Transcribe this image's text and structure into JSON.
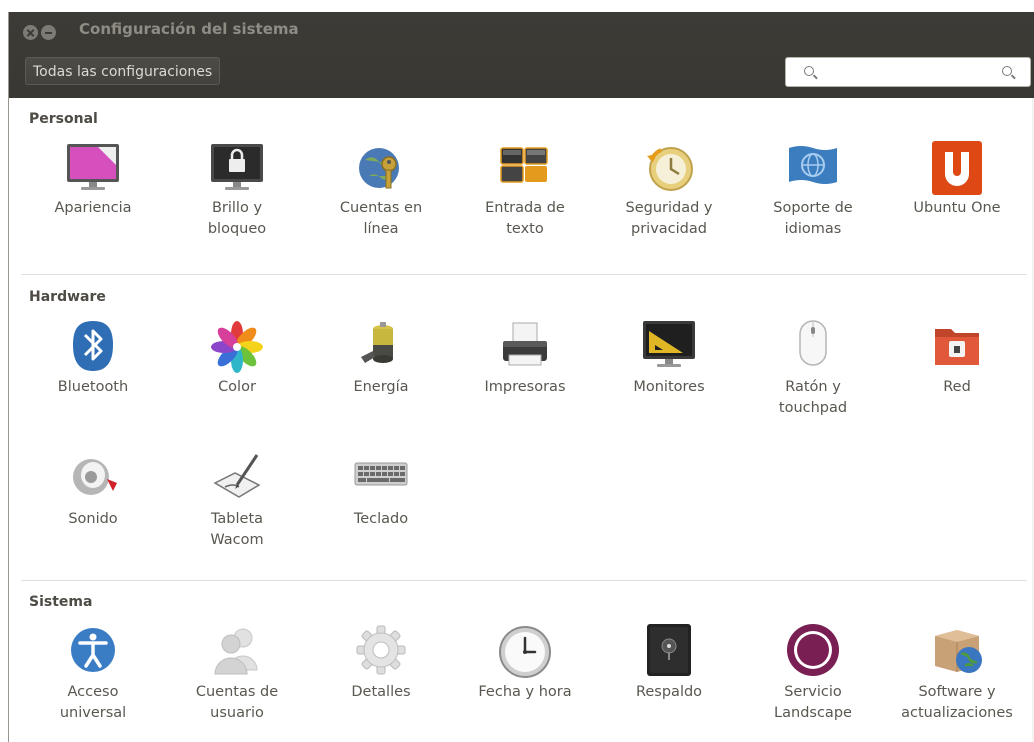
{
  "window": {
    "title": "Configuración del sistema",
    "all_settings_label": "Todas las configuraciones",
    "search_placeholder": ""
  },
  "sections": [
    {
      "title": "Personal",
      "items": [
        {
          "label": "Apariencia",
          "icon": "appearance-icon"
        },
        {
          "label": "Brillo y\nbloqueo",
          "icon": "brightness-lock-icon"
        },
        {
          "label": "Cuentas en\nlínea",
          "icon": "online-accounts-icon"
        },
        {
          "label": "Entrada de\ntexto",
          "icon": "text-entry-icon"
        },
        {
          "label": "Seguridad y\nprivacidad",
          "icon": "security-privacy-icon"
        },
        {
          "label": "Soporte de\nidiomas",
          "icon": "language-support-icon"
        },
        {
          "label": "Ubuntu One",
          "icon": "ubuntu-one-icon"
        }
      ]
    },
    {
      "title": "Hardware",
      "items": [
        {
          "label": "Bluetooth",
          "icon": "bluetooth-icon"
        },
        {
          "label": "Color",
          "icon": "color-icon"
        },
        {
          "label": "Energía",
          "icon": "power-icon"
        },
        {
          "label": "Impresoras",
          "icon": "printer-icon"
        },
        {
          "label": "Monitores",
          "icon": "displays-icon"
        },
        {
          "label": "Ratón y\ntouchpad",
          "icon": "mouse-icon"
        },
        {
          "label": "Red",
          "icon": "network-icon"
        },
        {
          "label": "Sonido",
          "icon": "sound-icon"
        },
        {
          "label": "Tableta\nWacom",
          "icon": "wacom-tablet-icon"
        },
        {
          "label": "Teclado",
          "icon": "keyboard-icon"
        }
      ]
    },
    {
      "title": "Sistema",
      "items": [
        {
          "label": "Acceso\nuniversal",
          "icon": "universal-access-icon"
        },
        {
          "label": "Cuentas de\nusuario",
          "icon": "user-accounts-icon"
        },
        {
          "label": "Detalles",
          "icon": "details-icon"
        },
        {
          "label": "Fecha y hora",
          "icon": "clock-icon"
        },
        {
          "label": "Respaldo",
          "icon": "backup-icon"
        },
        {
          "label": "Servicio\nLandscape",
          "icon": "landscape-icon"
        },
        {
          "label": "Software y\nactualizaciones",
          "icon": "software-updates-icon"
        }
      ]
    }
  ]
}
